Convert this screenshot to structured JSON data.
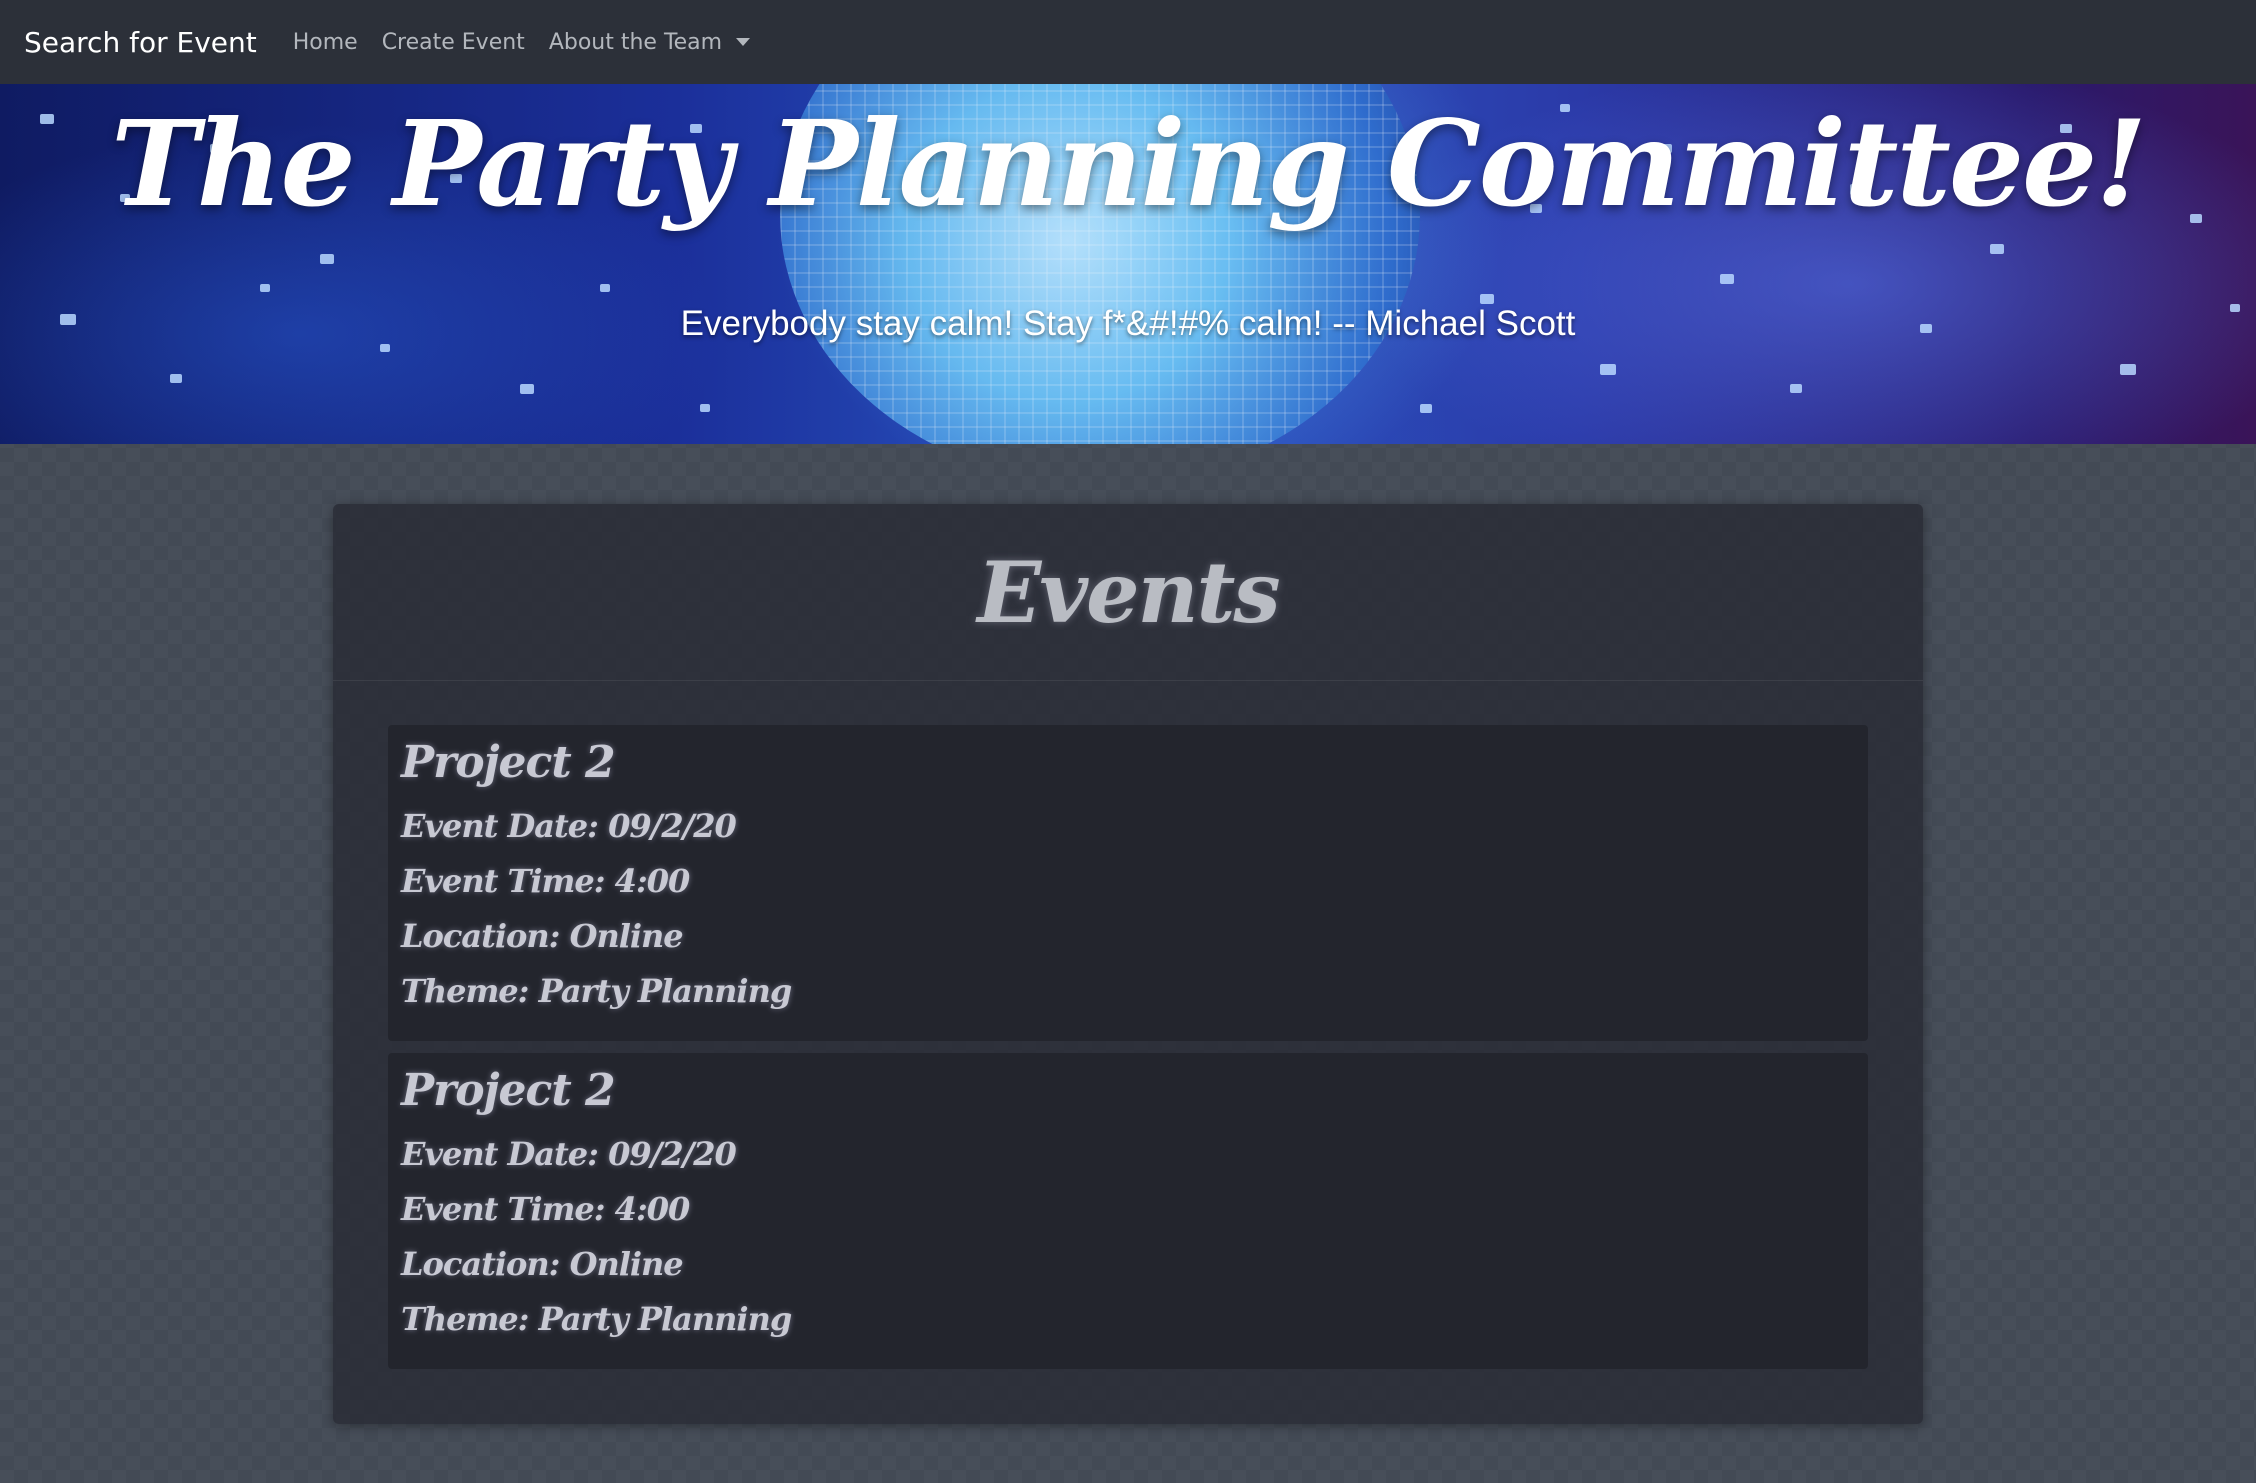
{
  "navbar": {
    "brand": "Search for Event",
    "links": [
      {
        "label": "Home"
      },
      {
        "label": "Create Event"
      },
      {
        "label": "About the Team"
      }
    ]
  },
  "hero": {
    "title": "The Party Planning Committee!",
    "quote": "Everybody stay calm! Stay f*&#!#% calm! -- Michael Scott"
  },
  "events": {
    "heading": "Events",
    "items": [
      {
        "name": "Project 2",
        "date": "Event Date: 09/2/20",
        "time": "Event Time: 4:00",
        "location": "Location: Online",
        "theme": "Theme: Party Planning"
      },
      {
        "name": "Project 2",
        "date": "Event Date: 09/2/20",
        "time": "Event Time: 4:00",
        "location": "Location: Online",
        "theme": "Theme: Party Planning"
      }
    ]
  },
  "colors": {
    "navbar_bg": "#2c3039",
    "page_bg": "#434a55",
    "panel_bg": "#282b34",
    "card_bg": "#23252d",
    "text_light": "#c8c9d3"
  }
}
